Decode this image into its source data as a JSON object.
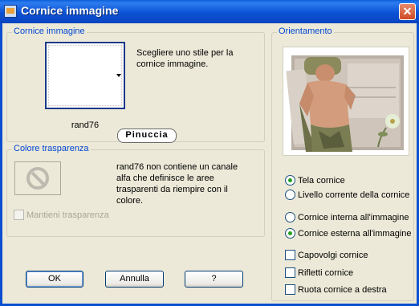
{
  "window": {
    "title": "Cornice immagine",
    "close_glyph": "✕"
  },
  "frame_group": {
    "legend": "Cornice immagine",
    "instruction": "Scegliere uno stile per la cornice immagine.",
    "selected_style": "rand76",
    "watermark": "Pinuccia"
  },
  "transparency_group": {
    "legend": "Colore trasparenza",
    "message": "rand76 non contiene un canale alfa che definisce le aree trasparenti da riempire con il colore.",
    "keep_transparency_label": "Mantieni trasparenza",
    "keep_transparency_checked": false,
    "keep_transparency_enabled": false
  },
  "orientation_group": {
    "legend": "Orientamento",
    "options_layer": [
      {
        "label": "Tela cornice",
        "selected": true
      },
      {
        "label": "Livello corrente della cornice",
        "selected": false
      }
    ],
    "options_position": [
      {
        "label": "Cornice interna all'immagine",
        "selected": false
      },
      {
        "label": "Cornice esterna all'immagine",
        "selected": true
      }
    ],
    "checkboxes": [
      {
        "label": "Capovolgi cornice",
        "checked": false
      },
      {
        "label": "Rifletti cornice",
        "checked": false
      },
      {
        "label": "Ruota cornice a destra",
        "checked": false
      }
    ]
  },
  "buttons": {
    "ok": "OK",
    "cancel": "Annulla",
    "help": "?"
  },
  "colors": {
    "title_bar": "#0b52d4",
    "group_legend": "#0046d5",
    "dialog_bg": "#ece9d8",
    "radio_dot": "#21a121"
  }
}
